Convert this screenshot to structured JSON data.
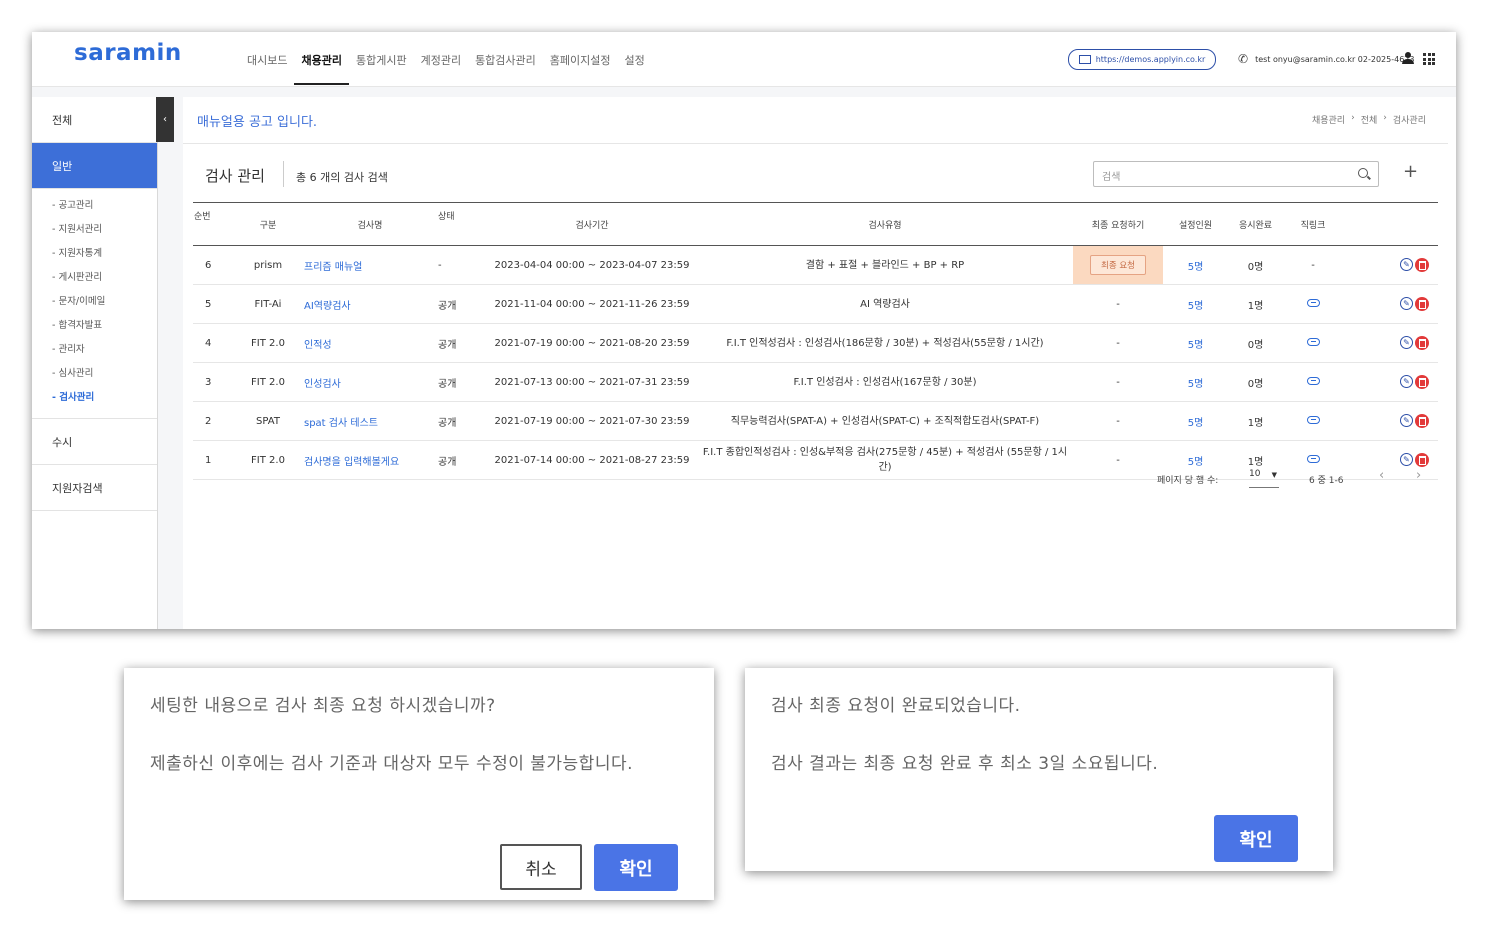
{
  "header": {
    "logo": "saramin",
    "nav": [
      "대시보드",
      "채용관리",
      "통합게시판",
      "계정관리",
      "통합검사관리",
      "홈페이지설정",
      "설정"
    ],
    "active_nav": "채용관리",
    "url": "https://demos.applyin.co.kr",
    "contact": "test onyu@saramin.co.kr 02-2025-4623"
  },
  "sidebar": {
    "top": "전체",
    "active_category": "일반",
    "sub_items": [
      "- 공고관리",
      "- 지원서관리",
      "- 지원자통계",
      "- 게시판관리",
      "- 문자/이메일",
      "- 합격자발표",
      "- 관리자",
      "- 심사관리",
      "- 검사관리"
    ],
    "active_sub": "- 검사관리",
    "other": [
      "수시",
      "지원자검색"
    ]
  },
  "main": {
    "notice": "매뉴얼용 공고 입니다.",
    "breadcrumb": [
      "채용관리",
      "›",
      "전체",
      "›",
      "검사관리"
    ],
    "section_title": "검사 관리",
    "count_text": "총 6 개의 검사 검색",
    "search_placeholder": "검색",
    "columns": [
      "순번",
      "구분",
      "검사명",
      "상태",
      "검사기간",
      "검사유형",
      "최종 요청하기",
      "설정인원",
      "응시완료",
      "직링크"
    ],
    "rows": [
      {
        "no": "6",
        "kind": "prism",
        "name": "프리즘 매뉴얼",
        "status": "-",
        "period": "2023-04-04 00:00 ~ 2023-04-07 23:59",
        "type": "결함 + 표절 + 블라인드 + BP + RP",
        "request": "최종 요청",
        "set": "5명",
        "done": "0명",
        "link": "-"
      },
      {
        "no": "5",
        "kind": "FIT-Ai",
        "name": "AI역량검사",
        "status": "공개",
        "period": "2021-11-04 00:00 ~ 2021-11-26 23:59",
        "type": "AI 역량검사",
        "request": "-",
        "set": "5명",
        "done": "1명",
        "link": "link"
      },
      {
        "no": "4",
        "kind": "FIT 2.0",
        "name": "인적성",
        "status": "공개",
        "period": "2021-07-19 00:00 ~ 2021-08-20 23:59",
        "type": "F.I.T 인적성검사 : 인성검사(186문항 / 30분) + 적성검사(55문항 / 1시간)",
        "request": "-",
        "set": "5명",
        "done": "0명",
        "link": "link"
      },
      {
        "no": "3",
        "kind": "FIT 2.0",
        "name": "인성검사",
        "status": "공개",
        "period": "2021-07-13 00:00 ~ 2021-07-31 23:59",
        "type": "F.I.T 인성검사 : 인성검사(167문항 / 30분)",
        "request": "-",
        "set": "5명",
        "done": "0명",
        "link": "link"
      },
      {
        "no": "2",
        "kind": "SPAT",
        "name": "spat 검사 테스트",
        "status": "공개",
        "period": "2021-07-19 00:00 ~ 2021-07-30 23:59",
        "type": "직무능력검사(SPAT-A) + 인성검사(SPAT-C) + 조직적합도검사(SPAT-F)",
        "request": "-",
        "set": "5명",
        "done": "1명",
        "link": "link"
      },
      {
        "no": "1",
        "kind": "FIT 2.0",
        "name": "검사명을 입력해볼게요",
        "status": "공개",
        "period": "2021-07-14 00:00 ~ 2021-08-27 23:59",
        "type": "F.I.T 종합인적성검사 : 인성&부적응 검사(275문항 / 45분) + 적성검사 (55문항 / 1시간)",
        "request": "-",
        "set": "5명",
        "done": "1명",
        "link": "link"
      }
    ],
    "pager": {
      "label": "페이지 당 행 수:",
      "per_page": "10",
      "range": "6 중 1-6",
      "prev": "‹",
      "next": "›"
    }
  },
  "dialog1": {
    "line1": "세팅한 내용으로 검사 최종 요청 하시겠습니까?",
    "line2": "제출하신 이후에는 검사 기준과 대상자 모두 수정이 불가능합니다.",
    "cancel": "취소",
    "ok": "확인"
  },
  "dialog2": {
    "line1": "검사 최종 요청이 완료되었습니다.",
    "line2": "검사 결과는 최종 요청 완료 후 최소 3일 소요됩니다.",
    "ok": "확인"
  },
  "colors": {
    "brand": "#2d6bd7",
    "accent_button": "#4a74e6",
    "request_highlight": "#fbd9c0",
    "delete": "#e23a3a"
  }
}
